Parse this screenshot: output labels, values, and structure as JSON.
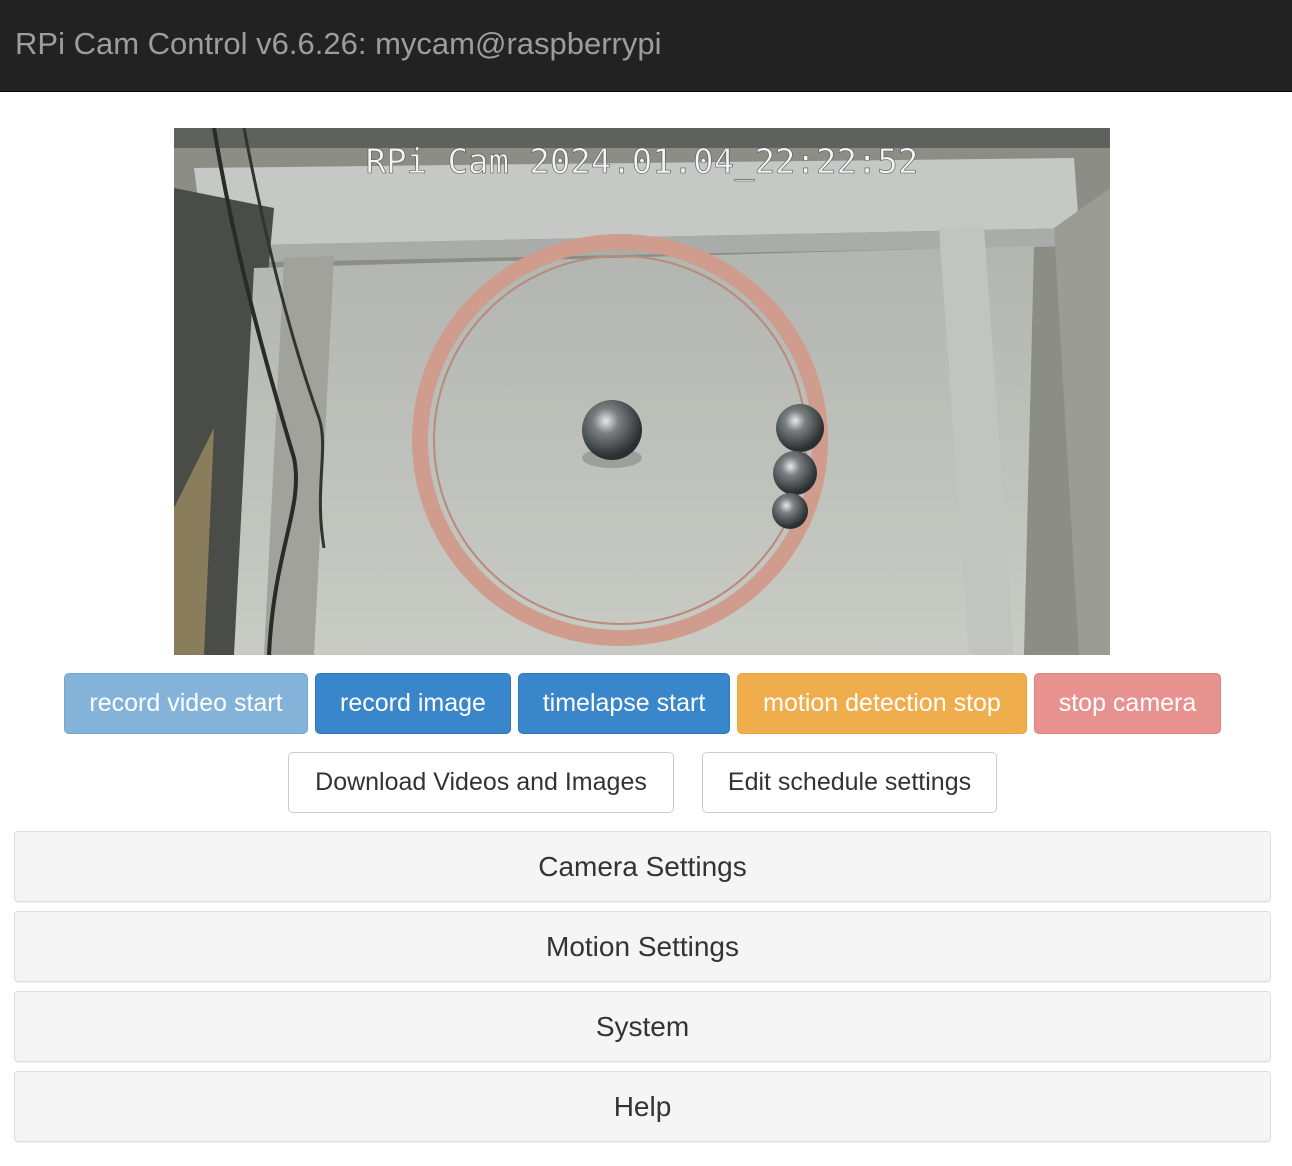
{
  "header": {
    "title": "RPi Cam Control v6.6.26: mycam@raspberrypi"
  },
  "preview": {
    "overlay_text": "RPi Cam  2024.01.04_22:22:52"
  },
  "buttons": {
    "record_video": "record video start",
    "record_image": "record image",
    "timelapse": "timelapse start",
    "motion_detection": "motion detection stop",
    "stop_camera": "stop camera",
    "download": "Download Videos and Images",
    "schedule": "Edit schedule settings"
  },
  "panels": {
    "camera_settings": "Camera Settings",
    "motion_settings": "Motion Settings",
    "system": "System",
    "help": "Help"
  },
  "colors": {
    "navbar": "#222222",
    "primary": "#3a86ca",
    "primary_disabled": "#84b3da",
    "warning": "#f0ad4e",
    "danger_disabled": "#e89290"
  }
}
